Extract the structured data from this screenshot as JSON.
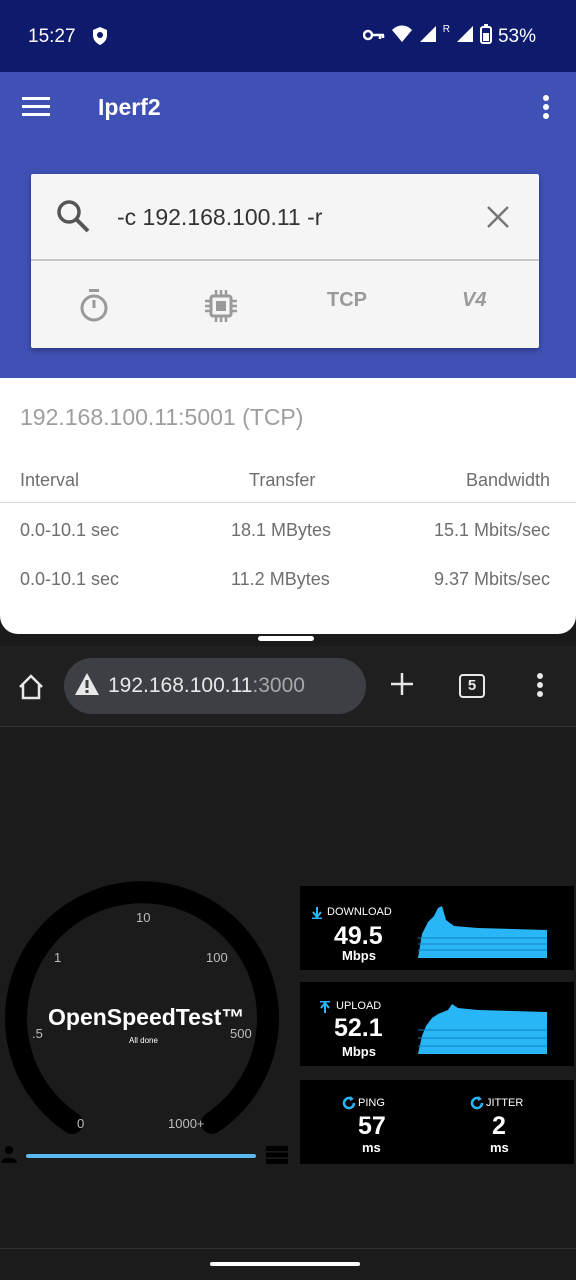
{
  "status": {
    "time": "15:27",
    "battery": "53%",
    "signal_flag": "R"
  },
  "app": {
    "title": "Iperf2"
  },
  "search": {
    "command": "-c 192.168.100.11 -r"
  },
  "options": {
    "protocol": "TCP",
    "ip_version": "V4"
  },
  "results": {
    "host": "192.168.100.11:5001 (TCP)",
    "headers": [
      "Interval",
      "Transfer",
      "Bandwidth"
    ],
    "rows": [
      [
        "0.0-10.1 sec",
        "18.1 MBytes",
        "15.1 Mbits/sec"
      ],
      [
        "0.0-10.1 sec",
        "11.2 MBytes",
        "9.37 Mbits/sec"
      ]
    ]
  },
  "browser": {
    "url_host": "192.168.100.11",
    "url_port": ":3000",
    "tab_count": "5"
  },
  "speedtest": {
    "brand": "OpenSpeedTest™",
    "status": "All done",
    "gauge_labels": {
      "l0": "0",
      "l_5": ".5",
      "l1": "1",
      "l10": "10",
      "l100": "100",
      "l500": "500",
      "l1000": "1000+"
    },
    "download": {
      "label": "DOWNLOAD",
      "value": "49.5",
      "unit": "Mbps"
    },
    "upload": {
      "label": "UPLOAD",
      "value": "52.1",
      "unit": "Mbps"
    },
    "ping": {
      "label": "PING",
      "value": "57",
      "unit": "ms"
    },
    "jitter": {
      "label": "JITTER",
      "value": "2",
      "unit": "ms"
    },
    "accent_color": "#29b6f6"
  }
}
